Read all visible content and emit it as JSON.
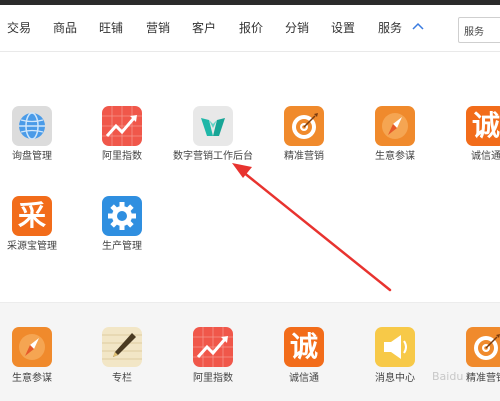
{
  "nav": {
    "items": [
      "交易",
      "商品",
      "旺铺",
      "营销",
      "客户",
      "报价",
      "分销",
      "设置",
      "服务"
    ],
    "select_value": "服务"
  },
  "apps": [
    {
      "label": "询盘管理",
      "icon": "globe-icon",
      "color": "#dcdcdc"
    },
    {
      "label": "阿里指数",
      "icon": "trend-chart-icon",
      "color": "#f0574a"
    },
    {
      "label": "数字营销工作后台",
      "icon": "teal-logo-icon",
      "color": "#e8e8e8"
    },
    {
      "label": "精准营销",
      "icon": "target-icon",
      "color": "#f08a2c"
    },
    {
      "label": "生意参谋",
      "icon": "compass-icon",
      "color": "#f08a2c"
    },
    {
      "label": "诚信通",
      "icon": "cheng-badge-icon",
      "glyph": "诚",
      "color": "#f26c1a"
    },
    {
      "label": "采源宝管理",
      "icon": "cai-badge-icon",
      "glyph": "采",
      "color": "#f26c1a"
    },
    {
      "label": "生产管理",
      "icon": "gear-icon",
      "color": "#2f8fe0"
    }
  ],
  "quick_apps": [
    {
      "label": "生意参谋",
      "icon": "compass-icon",
      "color": "#f08a2c"
    },
    {
      "label": "专栏",
      "icon": "pen-icon",
      "color": "#f2e6c6"
    },
    {
      "label": "阿里指数",
      "icon": "trend-chart-icon",
      "color": "#f0574a"
    },
    {
      "label": "诚信通",
      "icon": "cheng-badge-icon",
      "glyph": "诚",
      "color": "#f26c1a"
    },
    {
      "label": "消息中心",
      "icon": "speaker-icon",
      "color": "#f7c948"
    },
    {
      "label": "精准营销",
      "icon": "target-icon",
      "color": "#f08a2c"
    }
  ],
  "annotation": {
    "color": "#e8332f"
  },
  "watermark": "Baidu"
}
